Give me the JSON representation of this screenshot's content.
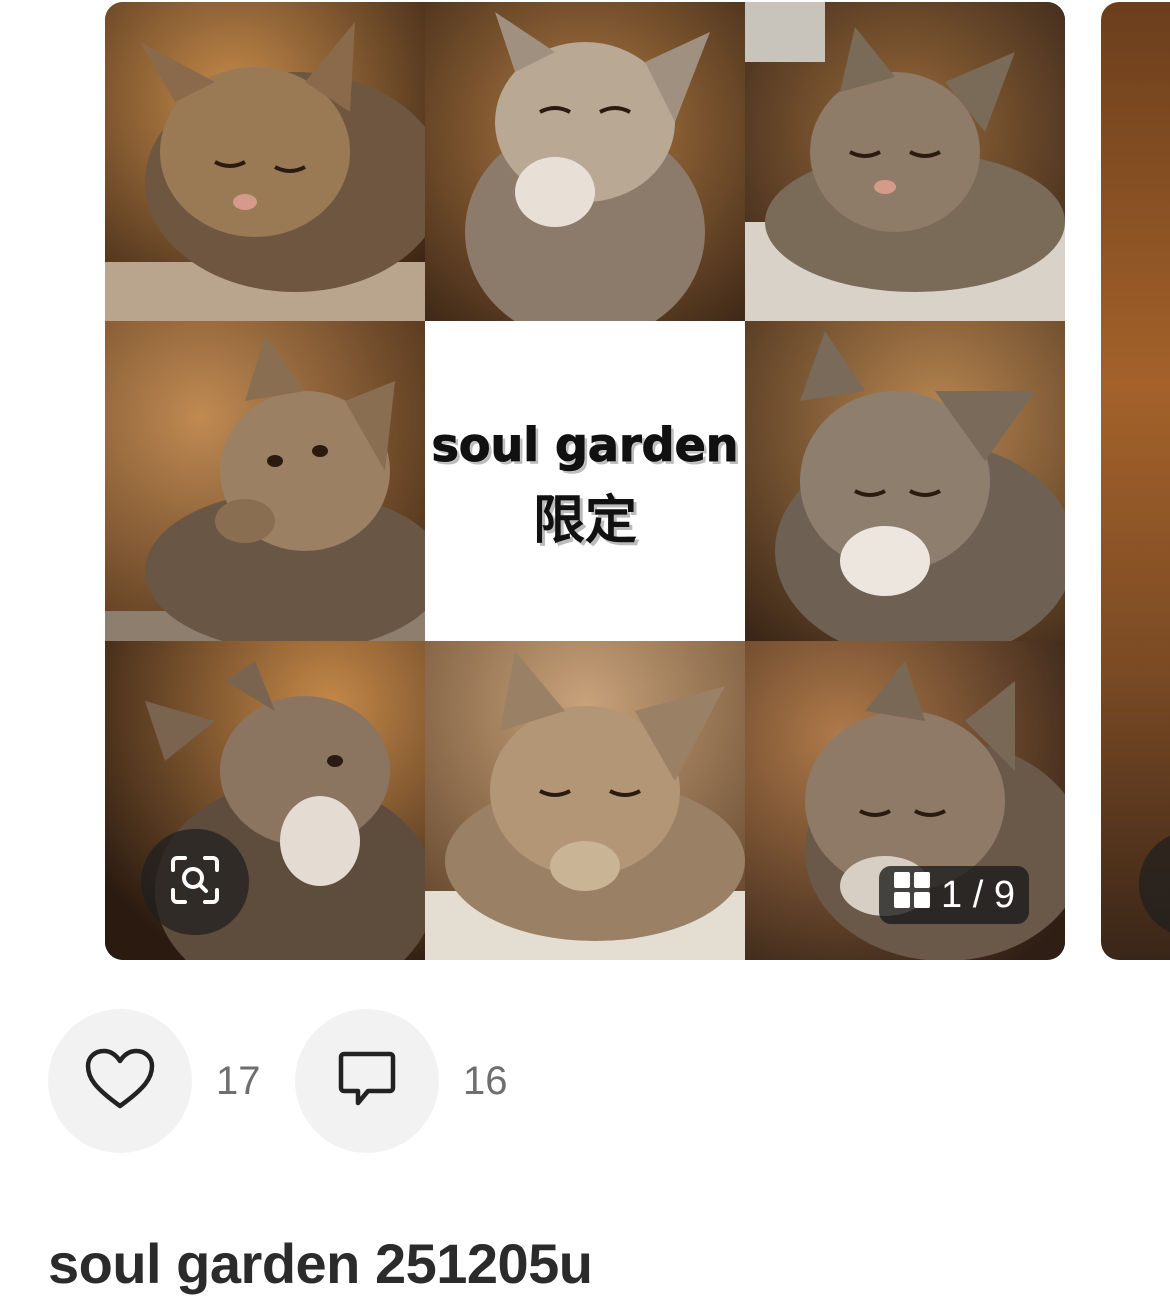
{
  "post": {
    "center_text_line1": "soul garden",
    "center_text_line2": "限定",
    "image_counter": "1 / 9",
    "likes": "17",
    "comments": "16",
    "title": "soul garden 251205u"
  },
  "icons": {
    "zoom": "scan-search-icon",
    "grid": "grid-icon",
    "like": "heart-icon",
    "comment": "speech-bubble-icon"
  },
  "colors": {
    "action_bg": "#f2f2f2",
    "count_text": "#6e6e6e",
    "title_text": "#2b2b2b",
    "overlay_bg": "#1e1e1e"
  }
}
